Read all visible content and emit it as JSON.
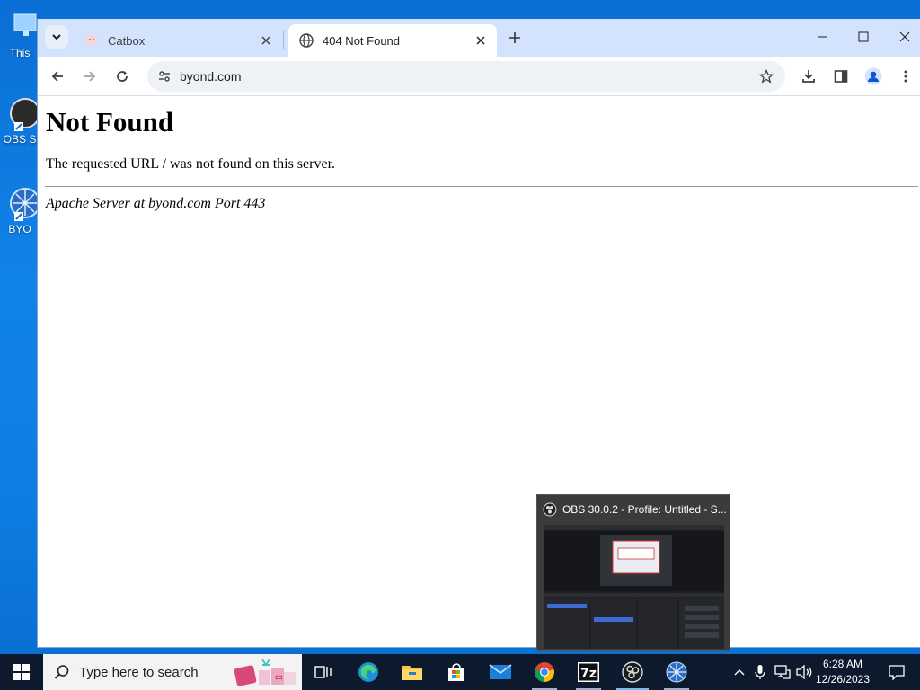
{
  "desktop": {
    "icons": [
      {
        "label": "This"
      },
      {
        "label": "OBS S"
      },
      {
        "label": "BYO"
      }
    ]
  },
  "browser": {
    "tabs": [
      {
        "title": "Catbox",
        "active": false
      },
      {
        "title": "404 Not Found",
        "active": true
      }
    ],
    "address": "byond.com"
  },
  "page": {
    "heading": "Not Found",
    "message": "The requested URL / was not found on this server.",
    "server_signature": "Apache Server at byond.com Port 443"
  },
  "preview": {
    "title": "OBS 30.0.2 - Profile: Untitled - S..."
  },
  "taskbar": {
    "search_placeholder": "Type here to search",
    "apps": [
      "task-view",
      "edge",
      "file-explorer",
      "microsoft-store",
      "mail",
      "chrome",
      "7zip",
      "obs-studio",
      "byond"
    ],
    "clock_time": "6:28 AM",
    "clock_date": "12/26/2023"
  },
  "colors": {
    "tabstrip": "#d3e3fd",
    "desktop": "#0e7ee4",
    "taskbar": "#0d1a2e"
  }
}
